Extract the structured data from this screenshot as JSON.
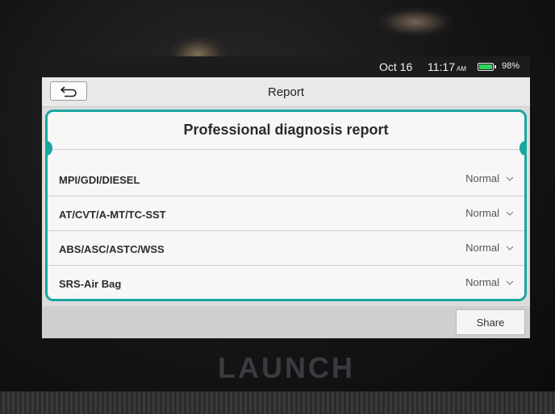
{
  "status_bar": {
    "date": "Oct 16",
    "time": "11:17",
    "ampm": "AM",
    "battery": "98%"
  },
  "header": {
    "title": "Report"
  },
  "report": {
    "heading": "Professional diagnosis report",
    "rows": [
      {
        "label": "MPI/GDI/DIESEL",
        "status": "Normal"
      },
      {
        "label": "AT/CVT/A-MT/TC-SST",
        "status": "Normal"
      },
      {
        "label": "ABS/ASC/ASTC/WSS",
        "status": "Normal"
      },
      {
        "label": "SRS-Air Bag",
        "status": "Normal"
      }
    ]
  },
  "footer": {
    "share_label": "Share"
  },
  "device": {
    "brand": "LAUNCH"
  },
  "icons": {
    "back": "back-arrow-icon",
    "chevron": "chevron-down-icon",
    "battery": "battery-icon"
  },
  "colors": {
    "accent": "#1aa6a0",
    "battery_fill": "#2fd35a"
  }
}
